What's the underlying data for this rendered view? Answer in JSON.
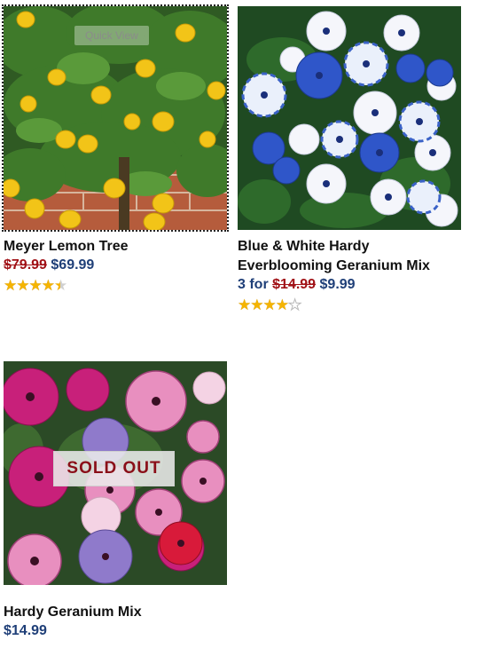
{
  "products": [
    {
      "name": "Meyer Lemon Tree",
      "old_price": "$79.99",
      "price": "$69.99",
      "prefix": "",
      "rating": 4.5,
      "stars": [
        "full",
        "full",
        "full",
        "full",
        "half"
      ],
      "overlay": "Quick View",
      "image_icon": "lemon-tree-photo"
    },
    {
      "name": "Blue & White Hardy Everblooming Geranium Mix",
      "prefix": "3 for ",
      "old_price": "$14.99",
      "price": "$9.99",
      "rating": 4,
      "stars": [
        "full",
        "full",
        "full",
        "full",
        "empty"
      ],
      "image_icon": "geranium-blue-white-photo"
    },
    {
      "name": "Hardy Geranium Mix",
      "price": "$14.99",
      "badge": "SOLD OUT",
      "image_icon": "geranium-pink-photo"
    }
  ],
  "colors": {
    "old_price": "#a11217",
    "price": "#1f3f78",
    "star": "#f5b400",
    "sold_out_text": "#8a0f18"
  }
}
